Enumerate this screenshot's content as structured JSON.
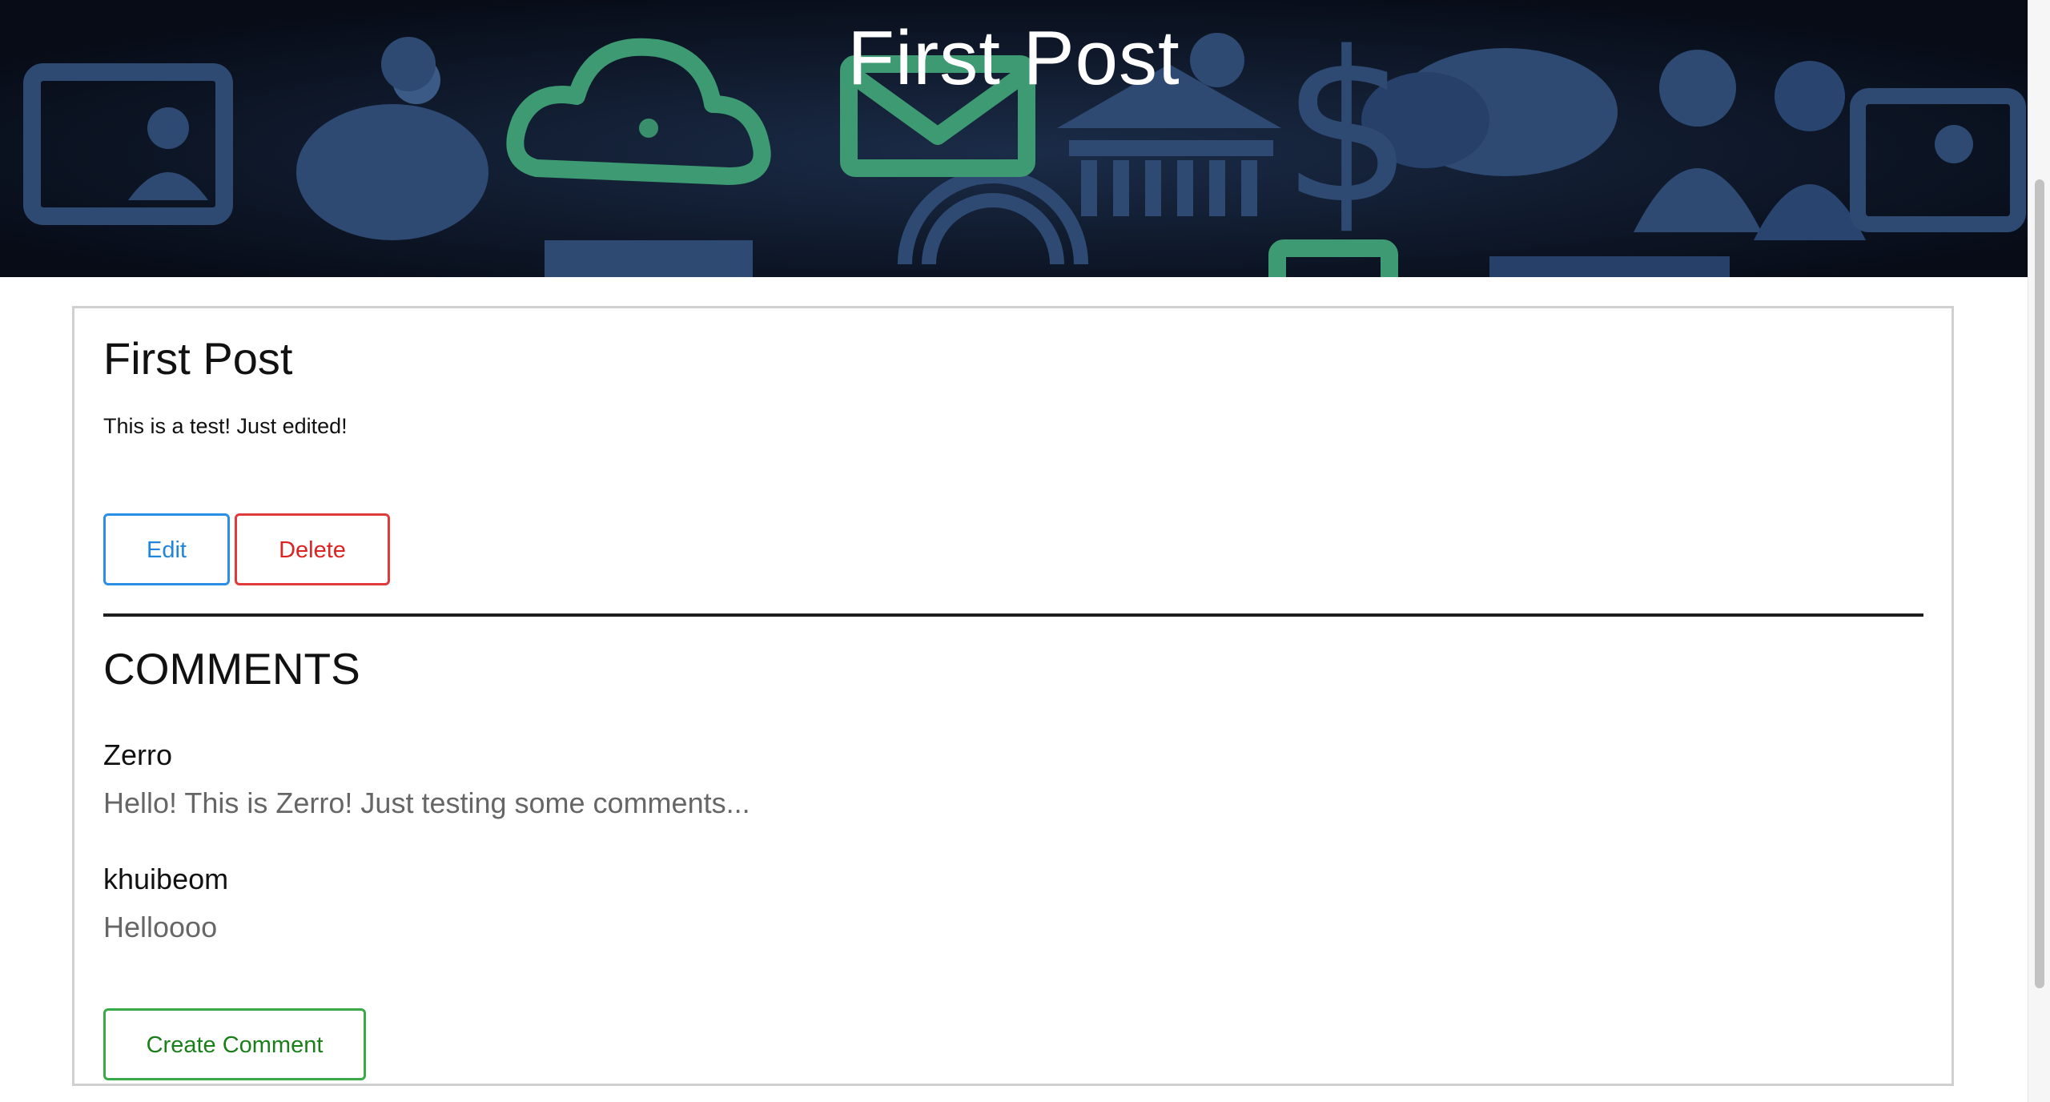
{
  "banner": {
    "title": "First Post"
  },
  "post": {
    "title": "First Post",
    "body": "This is a test! Just edited!",
    "edit_label": "Edit",
    "delete_label": "Delete"
  },
  "comments": {
    "heading": "COMMENTS",
    "items": [
      {
        "author": "Zerro",
        "text": "Hello! This is Zerro! Just testing some comments..."
      },
      {
        "author": "khuibeom",
        "text": "Helloooo"
      }
    ],
    "create_label": "Create Comment"
  },
  "colors": {
    "edit": "#2b8fe3",
    "delete": "#e03a3a",
    "create": "#3aaa48",
    "banner_icons": "#2e4a72",
    "banner_accent": "#3d9a72"
  }
}
